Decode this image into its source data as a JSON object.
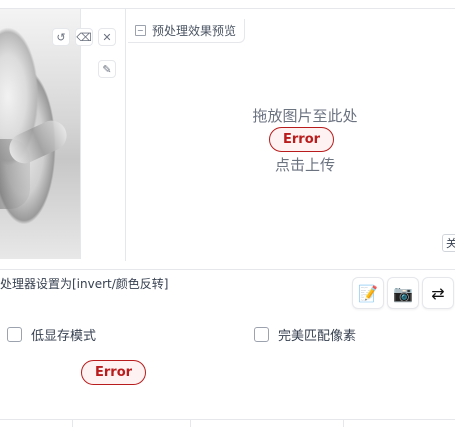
{
  "input_panel": {
    "image_alt": "",
    "tools": {
      "undo_icon": "↺",
      "erase_icon": "⌫",
      "close_icon": "✕",
      "brush_icon": "✎"
    }
  },
  "preview_panel": {
    "label": "预处理效果预览",
    "drop_text": "拖放图片至此处",
    "error_label": "Error",
    "upload_text": "点击上传",
    "close_partial": "关"
  },
  "settings": {
    "processor_text": "处理器设置为[invert/颜色反转]",
    "buttons": {
      "edit_icon": "📝",
      "camera_icon": "📷",
      "swap_icon": "⇄"
    }
  },
  "options": {
    "low_vram_label": "低显存模式",
    "low_vram_checked": false,
    "pixel_perfect_label": "完美匹配像素",
    "pixel_perfect_checked": false
  },
  "bottom_error": {
    "label": "Error"
  }
}
